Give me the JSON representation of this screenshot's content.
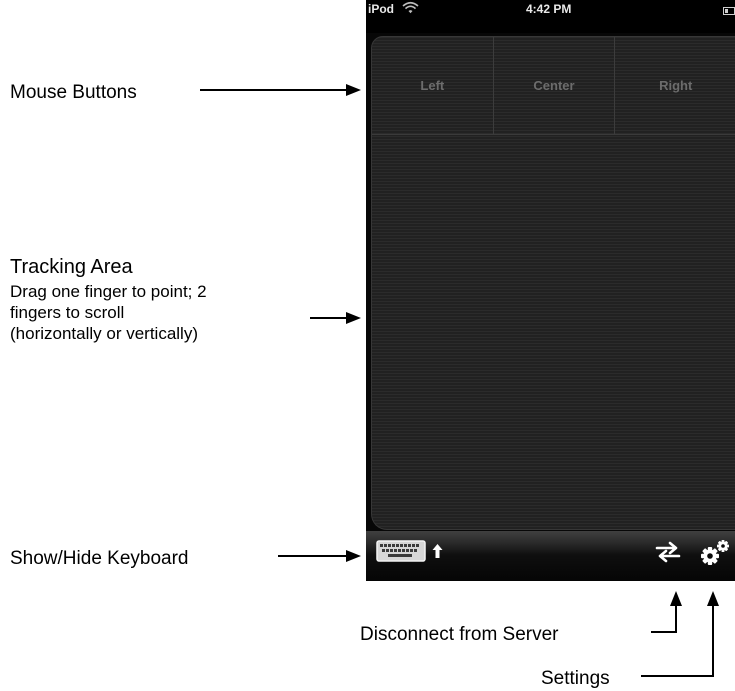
{
  "status_bar": {
    "carrier": "iPod",
    "time": "4:42 PM",
    "wifi_icon": "wifi-icon",
    "battery_icon": "battery-icon"
  },
  "mouse_buttons": [
    {
      "label": "Left"
    },
    {
      "label": "Center"
    },
    {
      "label": "Right"
    }
  ],
  "toolbar": {
    "keyboard_icon": "keyboard-icon",
    "arrow_icon": "arrow-up-icon",
    "disconnect_icon": "disconnect-arrows-icon",
    "settings_icon": "gears-icon"
  },
  "annotations": {
    "mouse_buttons": "Mouse Buttons",
    "tracking_area_title": "Tracking Area",
    "tracking_area_lines": [
      "Drag one finger to point; 2",
      "fingers to scroll",
      "(horizontally or vertically)"
    ],
    "keyboard": "Show/Hide Keyboard",
    "disconnect": "Disconnect from Server",
    "settings": "Settings"
  },
  "colors": {
    "phone_background": "#070707",
    "panel_background": "#262626",
    "button_label": "#6c6c6c",
    "status_text": "#e9e9e9",
    "annotation_text": "#000000"
  }
}
